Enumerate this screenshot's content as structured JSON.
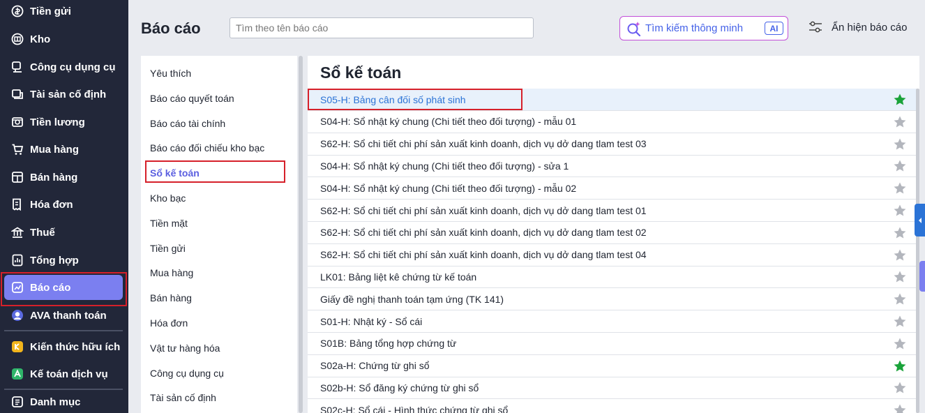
{
  "sidebar": {
    "items": [
      {
        "label": "Tiền gửi",
        "icon": "bank-deposit-icon"
      },
      {
        "label": "Kho",
        "icon": "warehouse-icon"
      },
      {
        "label": "Công cụ dụng cụ",
        "icon": "tools-icon"
      },
      {
        "label": "Tài sản cố định",
        "icon": "fixed-asset-icon"
      },
      {
        "label": "Tiền lương",
        "icon": "salary-icon"
      },
      {
        "label": "Mua hàng",
        "icon": "cart-icon"
      },
      {
        "label": "Bán hàng",
        "icon": "store-icon"
      },
      {
        "label": "Hóa đơn",
        "icon": "invoice-icon"
      },
      {
        "label": "Thuế",
        "icon": "tax-icon"
      },
      {
        "label": "Tổng hợp",
        "icon": "summary-icon"
      },
      {
        "label": "Báo cáo",
        "icon": "report-chart-icon"
      },
      {
        "label": "AVA thanh toán",
        "icon": "ava-avatar-icon"
      },
      {
        "label": "Kiến thức hữu ích",
        "icon": "knowledge-icon"
      },
      {
        "label": "Kế toán dịch vụ",
        "icon": "accounting-service-icon"
      },
      {
        "label": "Danh mục",
        "icon": "catalog-icon"
      }
    ],
    "active_index": 10
  },
  "header": {
    "title": "Báo cáo",
    "search_placeholder": "Tìm theo tên báo cáo",
    "smart_search_label": "Tìm kiếm thông minh",
    "ai_badge": "AI",
    "toggle_label": "Ẩn hiện báo cáo"
  },
  "categories": {
    "items": [
      "Yêu thích",
      "Báo cáo quyết toán",
      "Báo cáo tài chính",
      "Báo cáo đối chiếu kho bạc",
      "Sổ kế toán",
      "Kho bạc",
      "Tiền mặt",
      "Tiền gửi",
      "Mua hàng",
      "Bán hàng",
      "Hóa đơn",
      "Vật tư hàng hóa",
      "Công cụ dụng cụ",
      "Tài sản cố định"
    ],
    "active_index": 4
  },
  "report_list": {
    "title": "Sổ kế toán",
    "rows": [
      {
        "name": "S05-H: Bảng cân đối số phát sinh",
        "favorite": true,
        "selected": true
      },
      {
        "name": "S04-H: Sổ nhật ký chung (Chi tiết theo đối tượng) - mẫu 01",
        "favorite": false
      },
      {
        "name": "S62-H: Sổ chi tiết chi phí sản xuất kinh doanh, dịch vụ dở dang tlam test 03",
        "favorite": false
      },
      {
        "name": "S04-H: Sổ nhật ký chung (Chi tiết theo đối tượng) - sửa 1",
        "favorite": false
      },
      {
        "name": "S04-H: Sổ nhật ký chung (Chi tiết theo đối tượng) - mẫu 02",
        "favorite": false
      },
      {
        "name": "S62-H: Sổ chi tiết chi phí sản xuất kinh doanh, dịch vụ dở dang tlam test 01",
        "favorite": false
      },
      {
        "name": "S62-H: Sổ chi tiết chi phí sản xuất kinh doanh, dịch vụ dở dang tlam test 02",
        "favorite": false
      },
      {
        "name": "S62-H: Sổ chi tiết chi phí sản xuất kinh doanh, dịch vụ dở dang tlam test 04",
        "favorite": false
      },
      {
        "name": "LK01: Bảng liệt kê chứng từ kế toán",
        "favorite": false
      },
      {
        "name": "Giấy đề nghị thanh toán tạm ứng (TK 141)",
        "favorite": false
      },
      {
        "name": "S01-H: Nhật ký - Sổ cái",
        "favorite": false
      },
      {
        "name": "S01B: Bảng tổng hợp chứng từ",
        "favorite": false
      },
      {
        "name": "S02a-H: Chứng từ ghi sổ",
        "favorite": true
      },
      {
        "name": "S02b-H: Sổ đăng ký chứng từ ghi sổ",
        "favorite": false
      },
      {
        "name": "S02c-H: Sổ cái - Hình thức chứng từ ghi sổ",
        "favorite": false
      }
    ]
  },
  "colors": {
    "sidebar_bg": "#222739",
    "active_accent": "#7b7ff0",
    "highlight_border": "#d6202a",
    "favorite_star": "#1aa33a",
    "inactive_star": "#b3b6bd",
    "link_blue": "#2b73d6"
  }
}
